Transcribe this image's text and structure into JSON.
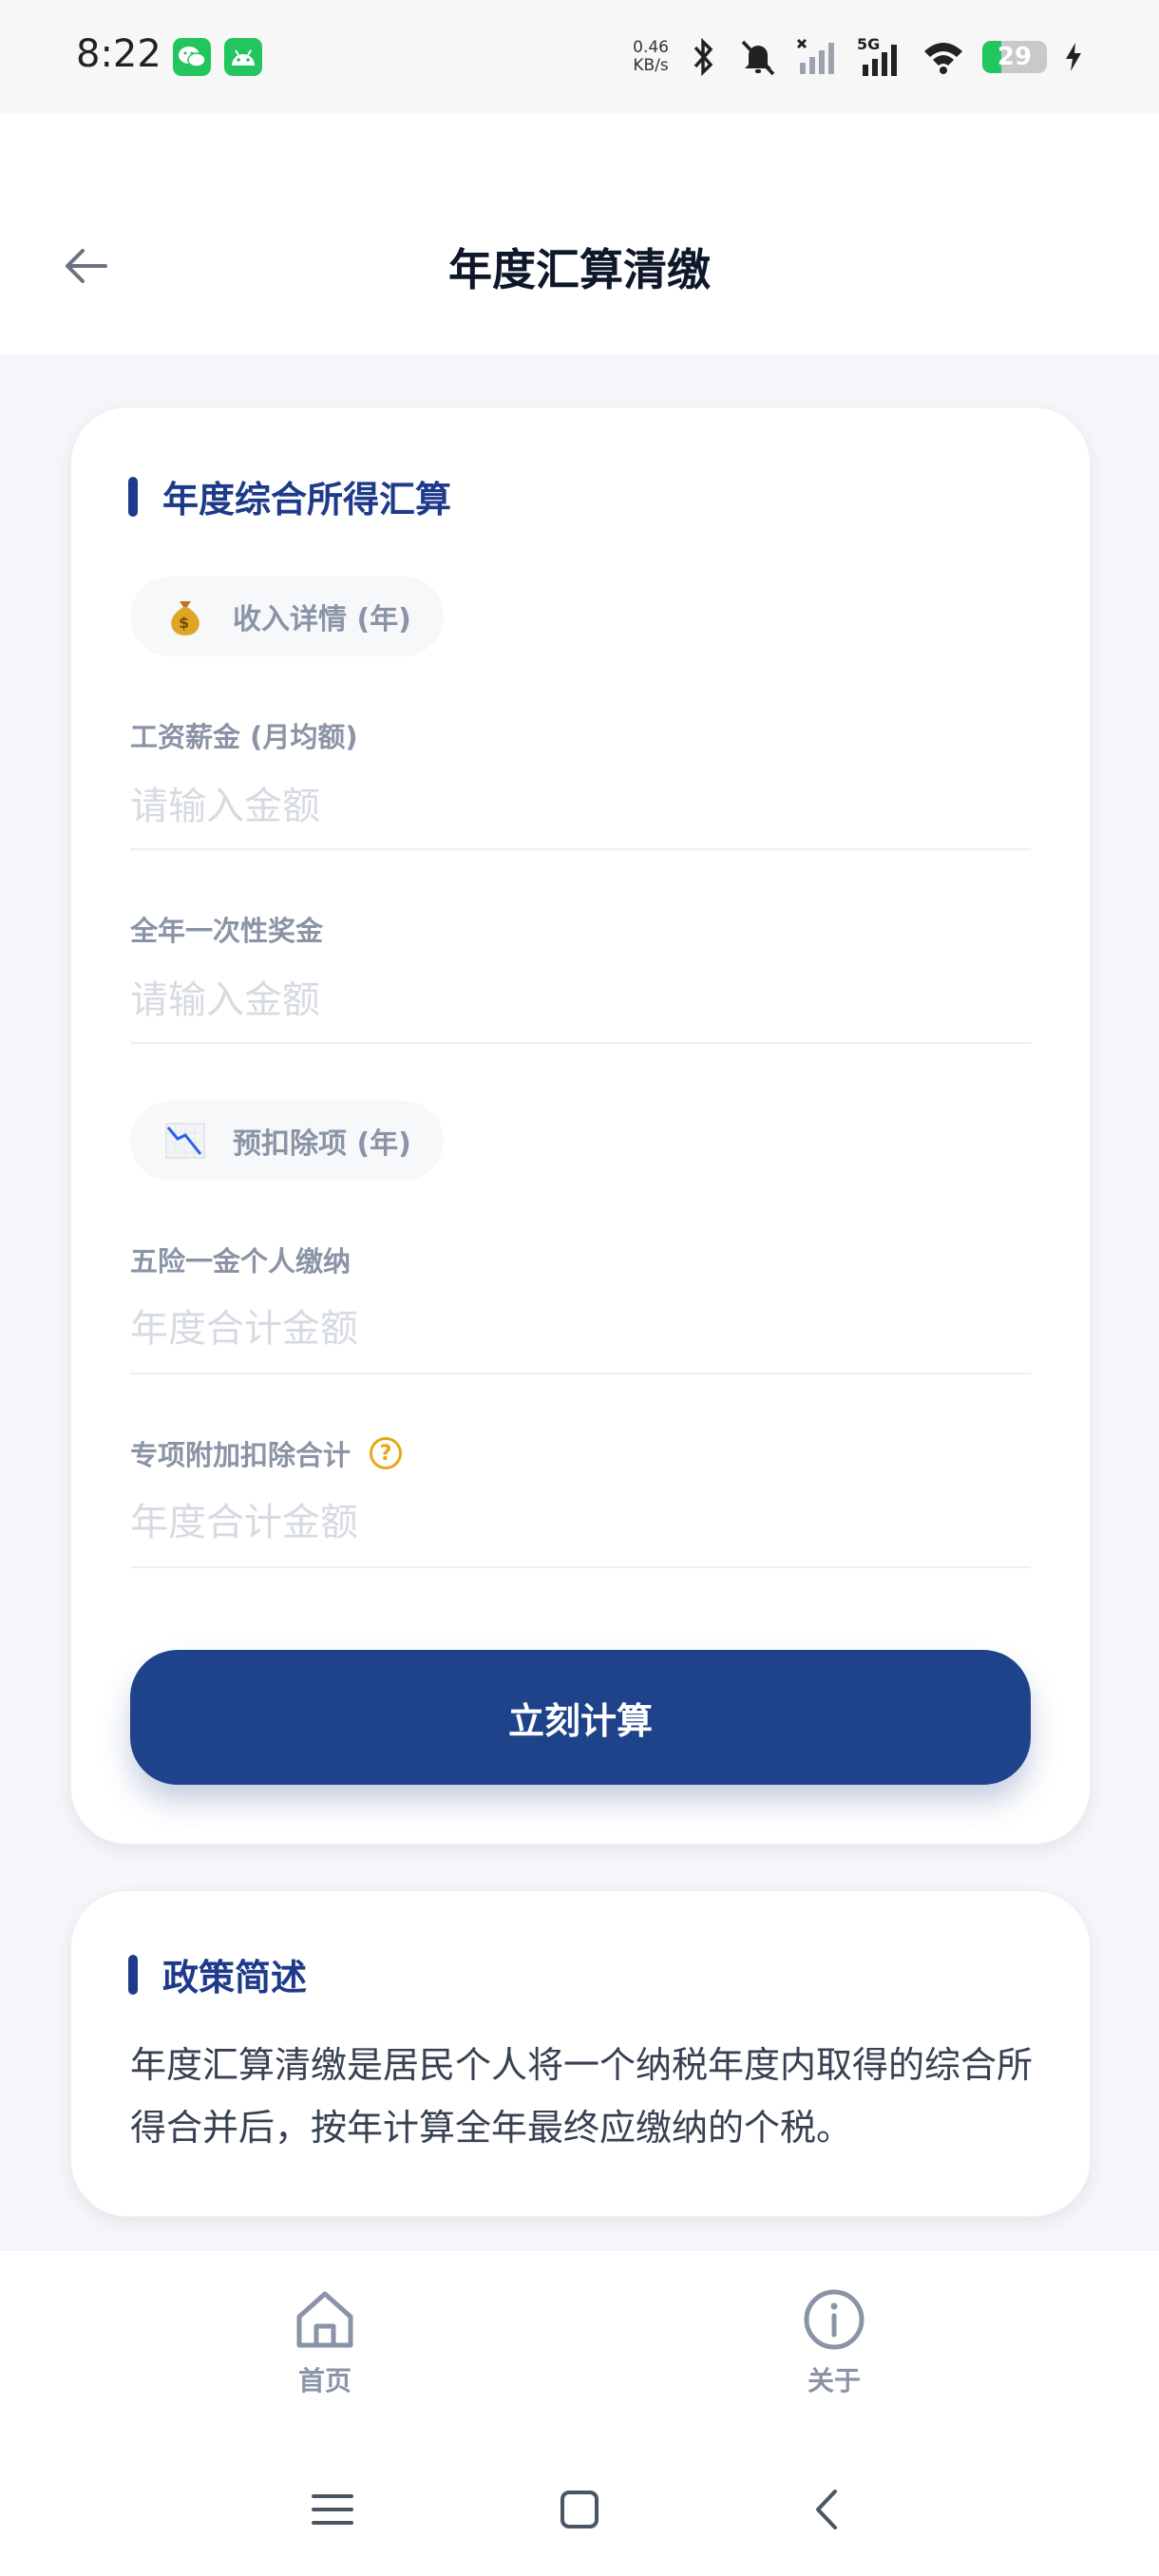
{
  "status_bar": {
    "time": "8:22",
    "net_speed_value": "0.46",
    "net_speed_unit": "KB/s",
    "network_type": "5G",
    "battery_level": "29",
    "app_icons": [
      "wechat-icon",
      "android-icon"
    ]
  },
  "header": {
    "title": "年度汇算清缴",
    "back_icon": "arrow-left-icon"
  },
  "calc_card": {
    "section_title": "年度综合所得汇算",
    "income_pill": {
      "icon": "money-bag-icon",
      "label": "收入详情 (年)"
    },
    "salary": {
      "label": "工资薪金 (月均额)",
      "placeholder": "请输入金额",
      "value": ""
    },
    "bonus": {
      "label": "全年一次性奖金",
      "placeholder": "请输入金额",
      "value": ""
    },
    "deduction_pill": {
      "icon": "chart-down-icon",
      "label": "预扣除项 (年)"
    },
    "insurance": {
      "label": "五险一金个人缴纳",
      "placeholder": "年度合计金额",
      "value": ""
    },
    "special": {
      "label": "专项附加扣除合计",
      "placeholder": "年度合计金额",
      "value": "",
      "help_icon": "question-circle-icon"
    },
    "button_label": "立刻计算"
  },
  "policy_card": {
    "section_title": "政策简述",
    "text": "年度汇算清缴是居民个人将一个纳税年度内取得的综合所得合并后，按年计算全年最终应缴纳的个税。"
  },
  "bottom_nav": {
    "items": [
      {
        "label": "首页",
        "icon": "home-icon"
      },
      {
        "label": "关于",
        "icon": "info-icon"
      }
    ]
  },
  "colors": {
    "primary": "#1e438a",
    "accent_title": "#1e3a8a",
    "muted_text": "#8a94a6",
    "help": "#e6a817",
    "battery": "#22c55e"
  }
}
